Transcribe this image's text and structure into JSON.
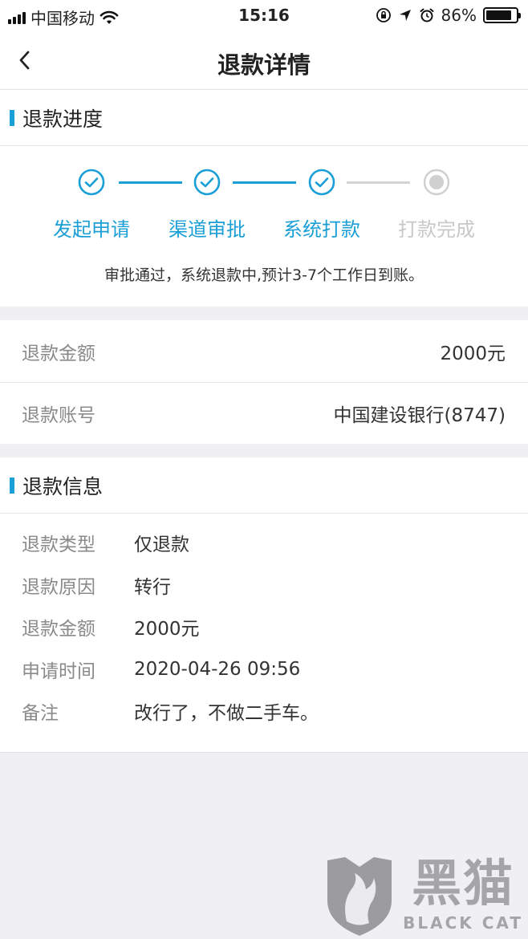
{
  "status_bar": {
    "carrier": "中国移动",
    "time": "15:16",
    "battery": "86%",
    "battery_level": 0.86
  },
  "nav": {
    "title": "退款详情"
  },
  "progress": {
    "section_title": "退款进度",
    "steps": [
      {
        "label": "发起申请",
        "state": "done"
      },
      {
        "label": "渠道审批",
        "state": "done"
      },
      {
        "label": "系统打款",
        "state": "done"
      },
      {
        "label": "打款完成",
        "state": "pending"
      }
    ],
    "status_text": "审批通过，系统退款中,预计3-7个工作日到账。"
  },
  "summary": {
    "rows": [
      {
        "label": "退款金额",
        "value": "2000元"
      },
      {
        "label": "退款账号",
        "value": "中国建设银行(8747)"
      }
    ]
  },
  "info": {
    "section_title": "退款信息",
    "rows": [
      {
        "label": "退款类型",
        "value": "仅退款"
      },
      {
        "label": "退款原因",
        "value": "转行"
      },
      {
        "label": "退款金额",
        "value": "2000元"
      },
      {
        "label": "申请时间",
        "value": "2020-04-26 09:56"
      },
      {
        "label": "备注",
        "value": "改行了，不做二手车。"
      }
    ]
  },
  "watermark": {
    "cn": "黑猫",
    "en": "BLACK CAT"
  },
  "colors": {
    "accent": "#1a9fd6",
    "pending": "#c8c8c8",
    "background": "#efeff4"
  }
}
